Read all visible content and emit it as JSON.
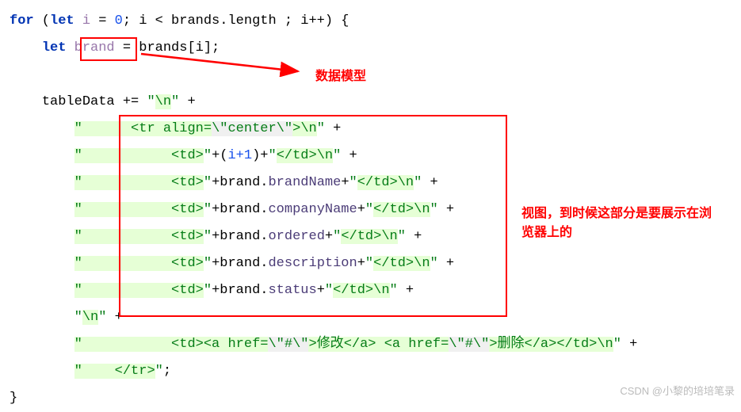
{
  "code": {
    "l1": {
      "kw1": "for",
      "pre": " (",
      "kw2": "let",
      "var": " i ",
      "eq": "= ",
      "num": "0",
      "cond": "; i < brands.length ; i++) {"
    },
    "l2": {
      "indent": "    ",
      "kw": "let",
      "var": " brand ",
      "rest": "= brands[i];"
    },
    "l3": {
      "indent": "    ",
      "lhs": "tableData += ",
      "q1": "\"",
      "esc": "\\n",
      "q2": "\"",
      "plus": " +"
    },
    "l4": {
      "indent": "        ",
      "q": "\"      ",
      "tag": "<tr ",
      "attr": "align=",
      "qv": "\\\"center\\\"",
      "close": ">",
      "esc": "\\n",
      "q2": "\"",
      "plus": " +"
    },
    "l5": {
      "indent": "        ",
      "q": "\"           ",
      "open": "<td>",
      "q2": "\"",
      "plus": "+(",
      "expr": "i+1",
      "plus2": ")+",
      "q3": "\"",
      "close": "</td>",
      "esc": "\\n",
      "q4": "\"",
      "end": " +"
    },
    "l6": {
      "indent": "        ",
      "q": "\"           ",
      "open": "<td>",
      "q2": "\"",
      "plus": "+brand.",
      "prop": "brandName",
      "plus2": "+",
      "q3": "\"",
      "close": "</td>",
      "esc": "\\n",
      "q4": "\"",
      "end": " +"
    },
    "l7": {
      "indent": "        ",
      "q": "\"           ",
      "open": "<td>",
      "q2": "\"",
      "plus": "+brand.",
      "prop": "companyName",
      "plus2": "+",
      "q3": "\"",
      "close": "</td>",
      "esc": "\\n",
      "q4": "\"",
      "end": " +"
    },
    "l8": {
      "indent": "        ",
      "q": "\"           ",
      "open": "<td>",
      "q2": "\"",
      "plus": "+brand.",
      "prop": "ordered",
      "plus2": "+",
      "q3": "\"",
      "close": "</td>",
      "esc": "\\n",
      "q4": "\"",
      "end": " +"
    },
    "l9": {
      "indent": "        ",
      "q": "\"           ",
      "open": "<td>",
      "q2": "\"",
      "plus": "+brand.",
      "prop": "description",
      "plus2": "+",
      "q3": "\"",
      "close": "</td>",
      "esc": "\\n",
      "q4": "\"",
      "end": " +"
    },
    "l10": {
      "indent": "        ",
      "q": "\"           ",
      "open": "<td>",
      "q2": "\"",
      "plus": "+brand.",
      "prop": "status",
      "plus2": "+",
      "q3": "\"",
      "close": "</td>",
      "esc": "\\n",
      "q4": "\"",
      "end": " +"
    },
    "l11": {
      "indent": "        ",
      "q": "\"",
      "esc": "\\n",
      "q2": "\"",
      "plus": " +"
    },
    "l12": {
      "indent": "        ",
      "q": "\"           ",
      "o1": "<td><a href=",
      "href": "\\\"#\\\"",
      "c1": ">",
      "txt1": "修改",
      "e1": "</a> <a href=",
      "href2": "\\\"#\\\"",
      "c2": ">",
      "txt2": "删除",
      "e2": "</a></td>",
      "esc": "\\n",
      "q2": "\"",
      "plus": " +"
    },
    "l13": {
      "indent": "        ",
      "q": "\"    ",
      "close": "</tr>",
      "q2": "\"",
      "semi": ";"
    },
    "l14": "}"
  },
  "annotations": {
    "model": "数据模型",
    "view": "视图，到时候这部分是要展示在浏览器上的"
  },
  "watermark": "CSDN @小黎的培培笔录"
}
